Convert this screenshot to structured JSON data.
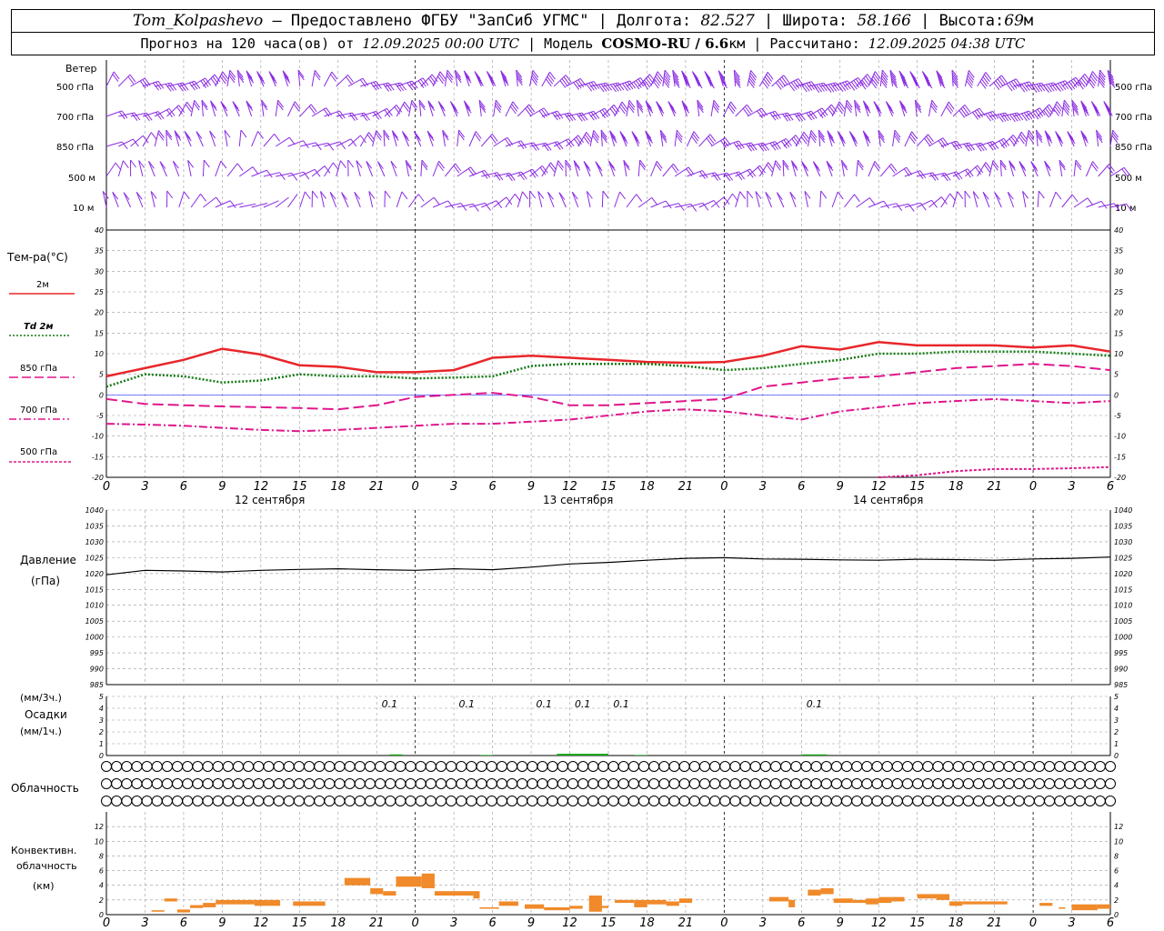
{
  "header": {
    "station": "Tom_Kolpashevo",
    "provider": "– Предоставлено ФГБУ \"ЗапСиб УГМС\" |",
    "lon_label": "Долгота:",
    "lon_value": "82.527",
    "lat_label": "| Широта:",
    "lat_value": "58.166",
    "alt_label": "| Высота:",
    "alt_value": "69",
    "alt_unit": "м",
    "forecast_label": "Прогноз на 120 часа(ов) от",
    "forecast_start": "12.09.2025 00:00 UTC",
    "model_label": "| Модель",
    "model_name": "COSMO-RU / 6.6",
    "model_unit": "км",
    "calc_label": "| Рассчитано:",
    "calc_time": "12.09.2025 04:38 UTC"
  },
  "colors": {
    "wind": "#8a2be2",
    "t2m": "#e8262a",
    "td2m": "#137a13",
    "t850": "#e0168c",
    "t700": "#e0168c",
    "t500": "#e0168c",
    "pressure": "#000000",
    "precip": "#18a818",
    "conv": "#f08a2a",
    "grid": "#9a9a9a",
    "zero": "#3030ff"
  },
  "chart_data": [
    {
      "type": "wind-barbs",
      "title": "Ветер",
      "levels": [
        "500 гПа",
        "700 гПа",
        "850 гПа",
        "500 м",
        "10 м"
      ],
      "speed_ms": [
        [
          12,
          14,
          15,
          15,
          16,
          15,
          14,
          13,
          12,
          12,
          13,
          14,
          15,
          16,
          17,
          18,
          19,
          20,
          21,
          22,
          22,
          23,
          23,
          23,
          23,
          23,
          23,
          23,
          24,
          24,
          24,
          24,
          24,
          24,
          24,
          24,
          25,
          25,
          25,
          25,
          25
        ],
        [
          9,
          10,
          10,
          11,
          11,
          10,
          9,
          8,
          8,
          9,
          10,
          11,
          12,
          12,
          13,
          13,
          14,
          15,
          15,
          16,
          16,
          17,
          17,
          17,
          17,
          17,
          17,
          17,
          17,
          17,
          17,
          17,
          17,
          18,
          18,
          18,
          18,
          18,
          18,
          18,
          18
        ],
        [
          7,
          7,
          8,
          8,
          7,
          6,
          6,
          6,
          6,
          7,
          8,
          9,
          10,
          10,
          11,
          11,
          12,
          12,
          13,
          13,
          13,
          14,
          14,
          14,
          14,
          14,
          14,
          14,
          14,
          14,
          14,
          14,
          14,
          15,
          15,
          15,
          15,
          15,
          15,
          15,
          15
        ],
        [
          5,
          5,
          5,
          6,
          5,
          4,
          4,
          4,
          4,
          5,
          6,
          7,
          8,
          8,
          9,
          9,
          10,
          10,
          10,
          10,
          10,
          10,
          10,
          10,
          10,
          10,
          10,
          10,
          10,
          10,
          10,
          10,
          10,
          11,
          11,
          11,
          11,
          11,
          11,
          11,
          11
        ],
        [
          3,
          3,
          3,
          3,
          3,
          2,
          2,
          2,
          3,
          3,
          4,
          4,
          4,
          4,
          5,
          5,
          5,
          5,
          5,
          5,
          5,
          4,
          4,
          4,
          4,
          4,
          4,
          4,
          4,
          4,
          4,
          4,
          4,
          4,
          4,
          4,
          4,
          4,
          4,
          4,
          4
        ]
      ]
    },
    {
      "type": "line",
      "title": "Тем-ра(°C)",
      "x_hours": [
        0,
        3,
        6,
        9,
        12,
        15,
        18,
        21,
        24,
        27,
        30,
        33,
        36,
        39,
        42,
        45,
        48,
        51,
        54,
        57,
        60,
        63,
        66,
        69,
        72,
        75,
        78
      ],
      "xlim": [
        0,
        78
      ],
      "ylim": [
        -20,
        40
      ],
      "yticks": [
        -20,
        -15,
        -10,
        -5,
        0,
        5,
        10,
        15,
        20,
        25,
        30,
        35,
        40
      ],
      "series": [
        {
          "name": "2м",
          "style": "solid",
          "values": [
            4.5,
            6.5,
            8.5,
            11.2,
            9.8,
            7.2,
            6.8,
            5.5,
            5.5,
            6.0,
            9.0,
            9.5,
            9.0,
            8.5,
            8.0,
            7.8,
            8.0,
            9.5,
            11.8,
            11.0,
            12.8,
            12.0,
            12.0,
            12.0,
            11.5,
            12.0,
            10.5
          ]
        },
        {
          "name": "Td 2м",
          "style": "dotted",
          "values": [
            2.0,
            5.0,
            4.5,
            3.0,
            3.5,
            5.0,
            4.5,
            4.5,
            4.0,
            4.2,
            4.5,
            7.0,
            7.5,
            7.5,
            7.5,
            7.0,
            6.0,
            6.5,
            7.5,
            8.5,
            10.0,
            10.0,
            10.5,
            10.5,
            10.5,
            10.0,
            9.5
          ]
        },
        {
          "name": "850 гПа",
          "style": "long-dash",
          "values": [
            -1.0,
            -2.2,
            -2.5,
            -2.8,
            -3.0,
            -3.2,
            -3.5,
            -2.5,
            -0.5,
            0.0,
            0.5,
            -0.5,
            -2.5,
            -2.5,
            -2.0,
            -1.5,
            -1.0,
            2.0,
            3.0,
            4.0,
            4.5,
            5.5,
            6.5,
            7.0,
            7.5,
            7.0,
            6.0
          ]
        },
        {
          "name": "700 гПа",
          "style": "dash-dot",
          "values": [
            -7.0,
            -7.2,
            -7.5,
            -8.0,
            -8.5,
            -8.8,
            -8.5,
            -8.0,
            -7.5,
            -7.0,
            -7.0,
            -6.5,
            -6.0,
            -5.0,
            -4.0,
            -3.5,
            -4.0,
            -5.0,
            -6.0,
            -4.0,
            -3.0,
            -2.0,
            -1.5,
            -1.0,
            -1.5,
            -2.0,
            -1.5
          ]
        },
        {
          "name": "500 гПа",
          "style": "short-dash",
          "x_hours": [
            60,
            63,
            66,
            69,
            72,
            75,
            78
          ],
          "values": [
            -20.0,
            -19.5,
            -18.5,
            -18.0,
            -18.0,
            -17.8,
            -17.5
          ]
        }
      ]
    },
    {
      "type": "line",
      "title": "Давление",
      "ylabel": "(гПа)",
      "x_hours": [
        0,
        3,
        6,
        9,
        12,
        15,
        18,
        21,
        24,
        27,
        30,
        33,
        36,
        39,
        42,
        45,
        48,
        51,
        54,
        57,
        60,
        63,
        66,
        69,
        72,
        75,
        78
      ],
      "ylim": [
        985,
        1040
      ],
      "yticks": [
        985,
        990,
        995,
        1000,
        1005,
        1010,
        1015,
        1020,
        1025,
        1030,
        1035,
        1040
      ],
      "series": [
        {
          "name": "",
          "values": [
            1019.6,
            1021.0,
            1020.8,
            1020.5,
            1021.0,
            1021.3,
            1021.5,
            1021.2,
            1021.0,
            1021.5,
            1021.2,
            1022.0,
            1023.0,
            1023.5,
            1024.2,
            1024.8,
            1025.0,
            1024.6,
            1024.5,
            1024.3,
            1024.2,
            1024.5,
            1024.4,
            1024.2,
            1024.6,
            1024.8,
            1025.2
          ]
        }
      ]
    },
    {
      "type": "bar",
      "title": "Осадки",
      "ylabel_top": "(мм/3ч.)",
      "ylabel_bottom": "(мм/1ч.)",
      "ylim": [
        0,
        5
      ],
      "yticks": [
        0,
        1,
        2,
        3,
        4,
        5
      ],
      "labels": [
        {
          "hour": 22,
          "text": "0.1"
        },
        {
          "hour": 28,
          "text": "0.1"
        },
        {
          "hour": 34,
          "text": "0.1"
        },
        {
          "hour": 37,
          "text": "0.1"
        },
        {
          "hour": 40,
          "text": "0.1"
        },
        {
          "hour": 55,
          "text": "0.1"
        }
      ],
      "bars": [
        {
          "from": 22,
          "to": 23,
          "value": 0.1
        },
        {
          "from": 29,
          "to": 30,
          "value": 0.05
        },
        {
          "from": 35,
          "to": 39,
          "value": 0.15
        },
        {
          "from": 41,
          "to": 42,
          "value": 0.05
        },
        {
          "from": 54,
          "to": 56,
          "value": 0.1
        }
      ]
    },
    {
      "type": "table",
      "title": "Облачность",
      "rows": [
        [
          0,
          0,
          0,
          0,
          0,
          0,
          0,
          0,
          0,
          0,
          0,
          0,
          0,
          0,
          0,
          0,
          0,
          0,
          0,
          0,
          0,
          0,
          0,
          0,
          0,
          0,
          0,
          0,
          0,
          0,
          0,
          0,
          0,
          0,
          0,
          0,
          0,
          0,
          0,
          0,
          0,
          0,
          0,
          0,
          0,
          0,
          0,
          0,
          0,
          0,
          0,
          0,
          0,
          0,
          0,
          0,
          0,
          0,
          0,
          0,
          0,
          0,
          0,
          0,
          0,
          0,
          0,
          0,
          0,
          0,
          0,
          0,
          0,
          0,
          0,
          0,
          0,
          0,
          0,
          0,
          0,
          0,
          0,
          0,
          0,
          0,
          0,
          0,
          0,
          0,
          0,
          0,
          0,
          0,
          0,
          0,
          0,
          0,
          0,
          0
        ],
        [
          0,
          0,
          0,
          0,
          0,
          0,
          0,
          0,
          0,
          0,
          0,
          0,
          0,
          0,
          0,
          0,
          0,
          0,
          0,
          0,
          0,
          0,
          0,
          0,
          0,
          0,
          0,
          0,
          0,
          0,
          0,
          0,
          0,
          0,
          0,
          0,
          0,
          0,
          0,
          0,
          0,
          0,
          0,
          0,
          0,
          0,
          0,
          0,
          0,
          0,
          0,
          0,
          0,
          0,
          0,
          0,
          0,
          0,
          0,
          0,
          0,
          0,
          0,
          0,
          0,
          0,
          0,
          0,
          0,
          0,
          0,
          0,
          0,
          0,
          0,
          0,
          0,
          0,
          0,
          0,
          0,
          0,
          0,
          0,
          0,
          0,
          0,
          0,
          0,
          0,
          0,
          0,
          0,
          0,
          0,
          0,
          0,
          0,
          0,
          0
        ],
        [
          0,
          0,
          0,
          0,
          0,
          0,
          0,
          0,
          0,
          0,
          0,
          0,
          0,
          0,
          0,
          0,
          0,
          0,
          0,
          0,
          0,
          0,
          0,
          0,
          0,
          0,
          0,
          0,
          0,
          0,
          0,
          0,
          0,
          0,
          0,
          0,
          0,
          0,
          0,
          0,
          0,
          0,
          0,
          0,
          0,
          0,
          0,
          0,
          0,
          0,
          0,
          0,
          0,
          0,
          0,
          0,
          0,
          0,
          0,
          0,
          0,
          0,
          0,
          0,
          0,
          0,
          0,
          0,
          0,
          0,
          0,
          0,
          0,
          0,
          0,
          0,
          0,
          0,
          0,
          0,
          0,
          0,
          0,
          0,
          0,
          0,
          0,
          0,
          0,
          0,
          0,
          0,
          0,
          0,
          0,
          0,
          0,
          0,
          0,
          0
        ]
      ]
    },
    {
      "type": "bar",
      "title": "Конвективн. облачность",
      "ylabel": "(км)",
      "ylim": [
        0,
        14
      ],
      "yticks": [
        0,
        2,
        4,
        6,
        8,
        10,
        12
      ],
      "bars": [
        {
          "from": 3.5,
          "to": 4.5,
          "base": 0.4,
          "top": 0.6
        },
        {
          "from": 4.5,
          "to": 5.5,
          "base": 1.8,
          "top": 2.2
        },
        {
          "from": 5.5,
          "to": 6.5,
          "base": 0.3,
          "top": 0.7
        },
        {
          "from": 6.5,
          "to": 7.5,
          "base": 0.9,
          "top": 1.3
        },
        {
          "from": 7.5,
          "to": 8.5,
          "base": 1.0,
          "top": 1.6
        },
        {
          "from": 8.5,
          "to": 11.5,
          "base": 1.4,
          "top": 2.0
        },
        {
          "from": 11.5,
          "to": 13.5,
          "base": 1.2,
          "top": 2.0
        },
        {
          "from": 14.5,
          "to": 17,
          "base": 1.2,
          "top": 1.8
        },
        {
          "from": 18.5,
          "to": 20.5,
          "base": 4.0,
          "top": 5.0
        },
        {
          "from": 20.5,
          "to": 21.5,
          "base": 2.8,
          "top": 3.6
        },
        {
          "from": 21.5,
          "to": 22.5,
          "base": 2.6,
          "top": 3.2
        },
        {
          "from": 22.5,
          "to": 24.5,
          "base": 3.8,
          "top": 5.2
        },
        {
          "from": 24.5,
          "to": 25.5,
          "base": 3.6,
          "top": 5.6
        },
        {
          "from": 25.5,
          "to": 28.5,
          "base": 2.6,
          "top": 3.2
        },
        {
          "from": 28.5,
          "to": 29,
          "base": 2.2,
          "top": 3.2
        },
        {
          "from": 29,
          "to": 30.5,
          "base": 0.8,
          "top": 1.0
        },
        {
          "from": 30.5,
          "to": 32,
          "base": 1.2,
          "top": 1.8
        },
        {
          "from": 32.5,
          "to": 34,
          "base": 0.8,
          "top": 1.4
        },
        {
          "from": 34,
          "to": 36,
          "base": 0.6,
          "top": 1.0
        },
        {
          "from": 36,
          "to": 37,
          "base": 0.8,
          "top": 1.2
        },
        {
          "from": 37.5,
          "to": 38.5,
          "base": 0.4,
          "top": 2.6
        },
        {
          "from": 38.5,
          "to": 39,
          "base": 0.9,
          "top": 1.2
        },
        {
          "from": 39.5,
          "to": 41,
          "base": 1.6,
          "top": 2.0
        },
        {
          "from": 41,
          "to": 42,
          "base": 1.0,
          "top": 2.0
        },
        {
          "from": 42,
          "to": 43.5,
          "base": 1.4,
          "top": 2.0
        },
        {
          "from": 43.5,
          "to": 44.5,
          "base": 1.2,
          "top": 1.8
        },
        {
          "from": 44.5,
          "to": 45.5,
          "base": 1.6,
          "top": 2.2
        },
        {
          "from": 51.5,
          "to": 53,
          "base": 1.8,
          "top": 2.4
        },
        {
          "from": 53,
          "to": 53.5,
          "base": 1.0,
          "top": 2.0
        },
        {
          "from": 54.5,
          "to": 55.5,
          "base": 2.6,
          "top": 3.4
        },
        {
          "from": 55.5,
          "to": 56.5,
          "base": 2.8,
          "top": 3.6
        },
        {
          "from": 56.5,
          "to": 58,
          "base": 1.6,
          "top": 2.2
        },
        {
          "from": 58,
          "to": 59,
          "base": 1.6,
          "top": 2.0
        },
        {
          "from": 59,
          "to": 60,
          "base": 1.4,
          "top": 2.2
        },
        {
          "from": 60,
          "to": 61,
          "base": 1.6,
          "top": 2.4
        },
        {
          "from": 61,
          "to": 62,
          "base": 1.8,
          "top": 2.4
        },
        {
          "from": 63,
          "to": 64.5,
          "base": 2.2,
          "top": 2.8
        },
        {
          "from": 64.5,
          "to": 65.5,
          "base": 2.0,
          "top": 2.8
        },
        {
          "from": 65.5,
          "to": 66.5,
          "base": 1.2,
          "top": 1.8
        },
        {
          "from": 66.5,
          "to": 70,
          "base": 1.4,
          "top": 1.8
        },
        {
          "from": 72.5,
          "to": 73.5,
          "base": 1.2,
          "top": 1.6
        },
        {
          "from": 74,
          "to": 74.5,
          "base": 0.8,
          "top": 1.0
        },
        {
          "from": 75,
          "to": 77,
          "base": 0.6,
          "top": 1.4
        },
        {
          "from": 77,
          "to": 78,
          "base": 0.8,
          "top": 1.4
        }
      ]
    }
  ],
  "axes": {
    "xticks": [
      "0",
      "3",
      "6",
      "9",
      "12",
      "15",
      "18",
      "21",
      "0",
      "3",
      "6",
      "9",
      "12",
      "15",
      "18",
      "21",
      "0",
      "3",
      "6",
      "9",
      "12",
      "15",
      "18",
      "21",
      "0",
      "3",
      "6"
    ],
    "dates": [
      "12 сентября",
      "13 сентября",
      "14 сентября"
    ]
  }
}
